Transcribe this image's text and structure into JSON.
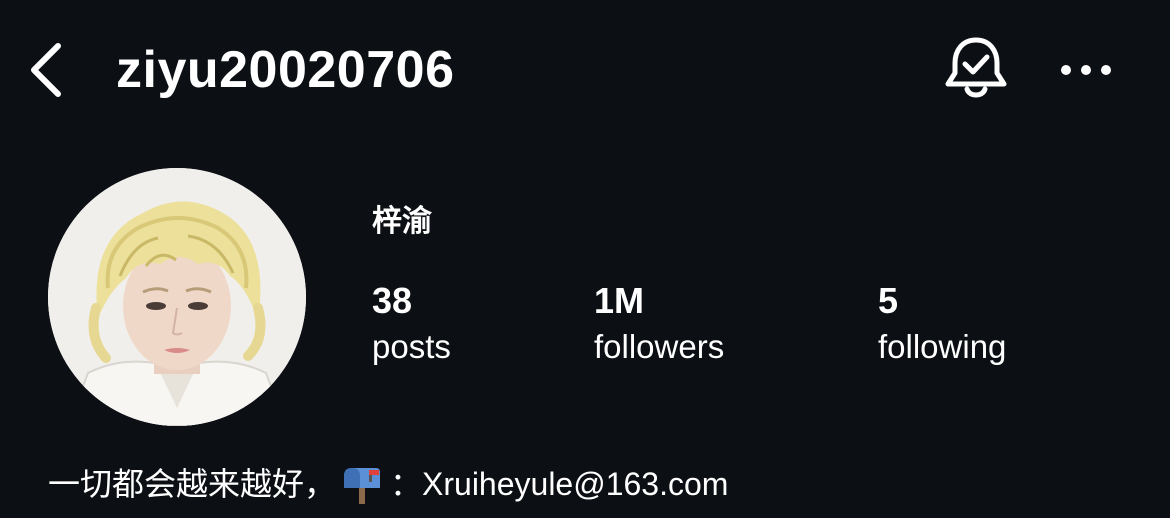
{
  "header": {
    "back_icon": "chevron-left-icon",
    "username": "ziyu20020706",
    "notification_icon": "bell-check-icon",
    "more_icon": "more-horizontal-icon"
  },
  "profile": {
    "display_name": "梓渝",
    "stats": [
      {
        "value": "38",
        "label": "posts"
      },
      {
        "value": "1M",
        "label": "followers"
      },
      {
        "value": "5",
        "label": "following"
      }
    ],
    "bio": {
      "text_before": "一切都会越来越好，",
      "icon": "mailbox-icon",
      "text_after": "：Xruiheyule@163.com"
    }
  },
  "colors": {
    "background": "#0c0f14",
    "text": "#ffffff"
  }
}
